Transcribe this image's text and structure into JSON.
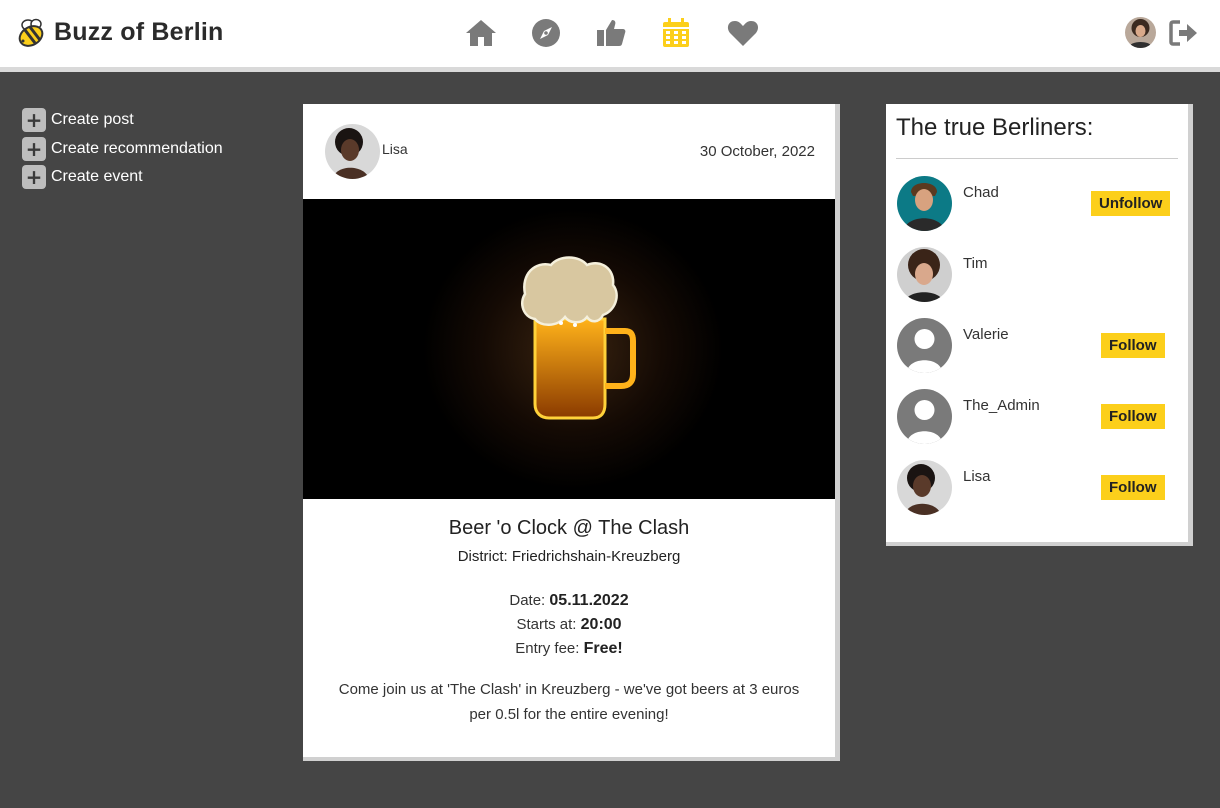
{
  "header": {
    "brand_title": "Buzz of Berlin",
    "logo_icon": "bee-icon",
    "nav": [
      {
        "icon": "home-icon",
        "active": false
      },
      {
        "icon": "compass-icon",
        "active": false
      },
      {
        "icon": "thumbs-up-icon",
        "active": false
      },
      {
        "icon": "calendar-icon",
        "active": true
      },
      {
        "icon": "heart-icon",
        "active": false
      }
    ],
    "nav_color": "#7a7a7a",
    "nav_active_color": "#fccf1b",
    "logout_icon": "logout-icon"
  },
  "actions": [
    {
      "label": "Create post"
    },
    {
      "label": "Create recommendation"
    },
    {
      "label": "Create event"
    }
  ],
  "post": {
    "author": "Lisa",
    "date": "30 October, 2022",
    "image": "neon-beer-mug",
    "title": "Beer 'o Clock @ The Clash",
    "district_label": "District:",
    "district": "Friedrichshain-Kreuzberg",
    "date_label": "Date:",
    "event_date": "05.11.2022",
    "start_label": "Starts at:",
    "start_time": "20:00",
    "fee_label": "Entry fee:",
    "fee": "Free!",
    "description": "Come join us at 'The Clash' in Kreuzberg - we've got beers at 3 euros per 0.5l for the entire evening!"
  },
  "sidebar": {
    "title": "The true Berliners:",
    "users": [
      {
        "name": "Chad",
        "action": "Unfollow"
      },
      {
        "name": "Tim",
        "action": ""
      },
      {
        "name": "Valerie",
        "action": "Follow"
      },
      {
        "name": "The_Admin",
        "action": "Follow"
      },
      {
        "name": "Lisa",
        "action": "Follow"
      }
    ]
  },
  "colors": {
    "background": "#454545",
    "accent": "#fccf1b",
    "card": "#ffffff"
  }
}
